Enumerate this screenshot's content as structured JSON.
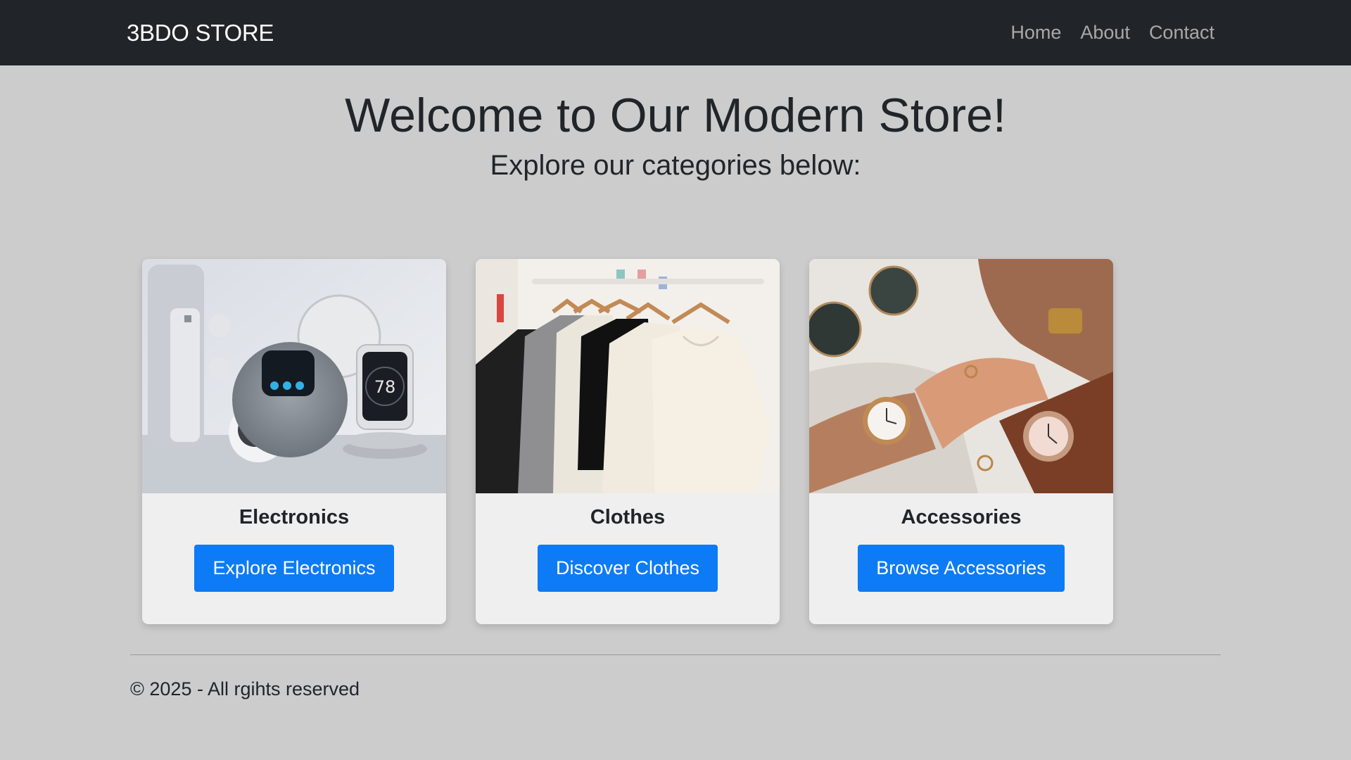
{
  "navbar": {
    "brand": "3BDO STORE",
    "links": [
      {
        "label": "Home"
      },
      {
        "label": "About"
      },
      {
        "label": "Contact"
      }
    ]
  },
  "hero": {
    "title": "Welcome to Our Modern Store!",
    "subtitle": "Explore our categories below:"
  },
  "categories": [
    {
      "title": "Electronics",
      "button": "Explore Electronics",
      "image": "smart-home-devices"
    },
    {
      "title": "Clothes",
      "button": "Discover Clothes",
      "image": "clothes-on-hangers"
    },
    {
      "title": "Accessories",
      "button": "Browse Accessories",
      "image": "watches-sunglasses-handbag"
    }
  ],
  "footer": {
    "text": "© 2025 - All rgihts reserved"
  },
  "colors": {
    "navbar": "#212529",
    "page_background": "#cccccc",
    "card_background": "#efefef",
    "button_primary": "#0d7bf5"
  }
}
